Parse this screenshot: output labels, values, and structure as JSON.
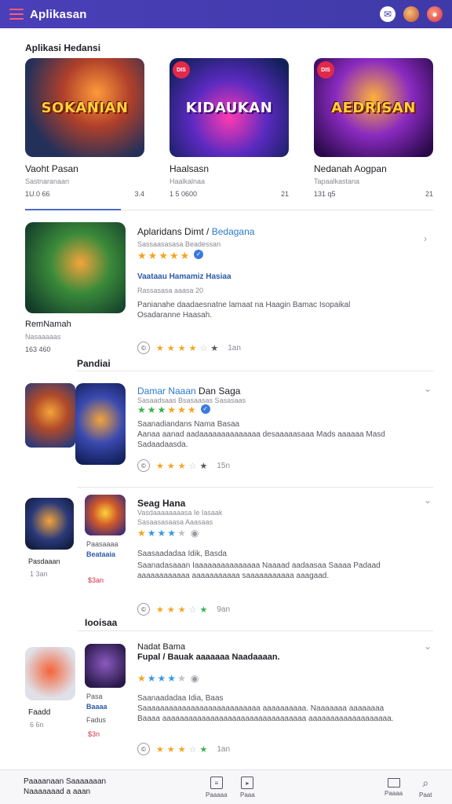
{
  "appbar": {
    "title": "Aplikasan",
    "icons": [
      "menu-icon",
      "chat-icon",
      "avatar-icon",
      "notification-icon"
    ]
  },
  "featured": {
    "section_title": "Aplikasi Hedansi",
    "cards": [
      {
        "art_text": "SOKANIAN",
        "badge": "",
        "name": "Vaoht Pasan",
        "sub": "Sastnaranaan",
        "meta_left": "1U.0 66",
        "meta_right": "3.4"
      },
      {
        "art_text": "KIDAUKAN",
        "badge": "DIS",
        "name": "Haalsasn",
        "sub": "Haalkalnaa",
        "meta_left": "1 5 0600",
        "meta_right": "21"
      },
      {
        "art_text": "AEDRISAN",
        "badge": "DIS",
        "name": "Nedanah Aogpan",
        "sub": "Tapaalkastana",
        "meta_left": "131 q5",
        "meta_right": "21"
      }
    ]
  },
  "rows": {
    "r1": {
      "title": "Aplaridans Dimt /",
      "title_blue": "Bedagana",
      "sub": "Sassaasasasa Beadessan",
      "blue_text": "Vaataau Hamamiz Hasiaa",
      "sub2": "Rassasasa aaasa 20",
      "desc1": "Panianahe daadaesnatne lamaat na Haagin Bamac Isopaikal",
      "desc2": "Osadaranne Haasah.",
      "left_caption": "RemNamah",
      "left_sub": "Nasaaaaas",
      "left_price": "163 460",
      "rating_time": "1an"
    },
    "section2_title": "Pandiai",
    "r2": {
      "title_blue": "Damar Naaan",
      "title": "Dan Saga",
      "sub": "Sasaadsaas Bsasaasas   Sasasaas",
      "desc_title": "Saanadiandans Nama Basaa",
      "desc1": "Aanaa aanad aadaaaaaaaaaaaaaa desaaaaasaaa Mads aaaaaa Masd",
      "desc2": "Sadaadaasda.",
      "rating_time": "15n"
    },
    "r3": {
      "title": "Seag Hana",
      "sub": "Vasdaaaaaaaasa Ie Iasaak",
      "sub2": "Sasaasasaasa Aaasaas",
      "desc_title": "Saasaadadaa Idik, Basda",
      "desc1": "Saanadasaaan Iaaaaaaaaaaaaaaa Naaaad aadaasaa Saaaa Padaad",
      "desc2": "aaaaaaaaaaaa aaaaaaaaaaa saaaaaaaaaaa aaagaad.",
      "left_caption": "Pasdaaan",
      "left_sub": "1 3an",
      "mid_caption": "Paasaaaa",
      "mid_blue": "Beataaia",
      "mid_price": "$3an",
      "rating_time": "9an"
    },
    "section3_title": "Iooisaa",
    "r4": {
      "title": "Nadat Bama",
      "title2": "Fupal / Bauak aaaaaaa Naadaaaan.",
      "desc_title": "Saanaadadaa Idia, Baas",
      "desc1": "Saaaaaaaaaaaaaaaaaaaaaaaaaaa aaaaaaaaaa. Naaaaaaa aaaaaaaa",
      "desc2": "Baaaa aaaaaaaaaaaaaaaaaaaaaaaaaaaaaaaaa aaaaaaaaaaaaaaaaaaa.",
      "left_caption": "Faadd",
      "left_sub": "6 6n",
      "mid_caption": "Pasa",
      "mid_blue": "Baaaa",
      "mid_sub": "Fadus",
      "mid_price": "$3n",
      "rating_time": "1an"
    }
  },
  "bottombar": {
    "left_line1": "Paaaanaan Saaaaaaan",
    "left_line2": "Naaaaaaad a aaan",
    "items": [
      {
        "label": "Paaaaa",
        "icon": "document-icon"
      },
      {
        "label": "Paaa",
        "icon": "play-icon"
      },
      {
        "label": "Paaaa",
        "icon": "folder-icon"
      },
      {
        "label": "Paat",
        "icon": "search-icon"
      }
    ]
  },
  "colors": {
    "appbar": "#4a3fb8",
    "accent": "#2a7ad0",
    "star": "#f4a420",
    "price_red": "#d0304a"
  }
}
